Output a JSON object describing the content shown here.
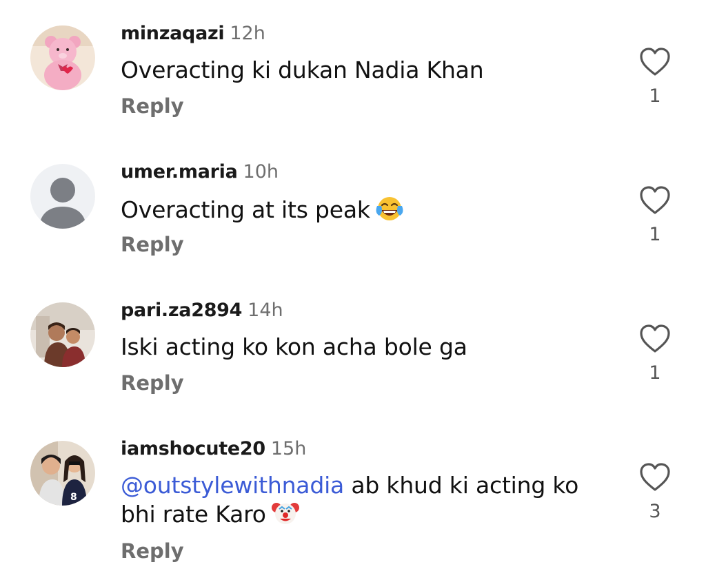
{
  "comments": [
    {
      "username": "minzaqazi",
      "time": "12h",
      "text": "Overacting ki dukan Nadia Khan",
      "reply_label": "Reply",
      "likes": "1",
      "avatar_icon": "teddy-bear-avatar"
    },
    {
      "username": "umer.maria",
      "time": "10h",
      "text": "Overacting at its peak",
      "emoji": "😂",
      "reply_label": "Reply",
      "likes": "1",
      "avatar_icon": "default-user-avatar"
    },
    {
      "username": "pari.za2894",
      "time": "14h",
      "text": "Iski acting ko kon acha bole ga",
      "reply_label": "Reply",
      "likes": "1",
      "avatar_icon": "photo-avatar"
    },
    {
      "username": "iamshocute20",
      "time": "15h",
      "mention": "@outstylewithnadia",
      "text": " ab khud ki acting ko bhi rate Karo",
      "emoji": "🤡",
      "reply_label": "Reply",
      "likes": "3",
      "avatar_icon": "photo-avatar"
    }
  ],
  "colors": {
    "username": "#1a1a1a",
    "secondary": "#6e6e6e",
    "mention": "#3b5bd6",
    "heart_outline": "#555555"
  }
}
